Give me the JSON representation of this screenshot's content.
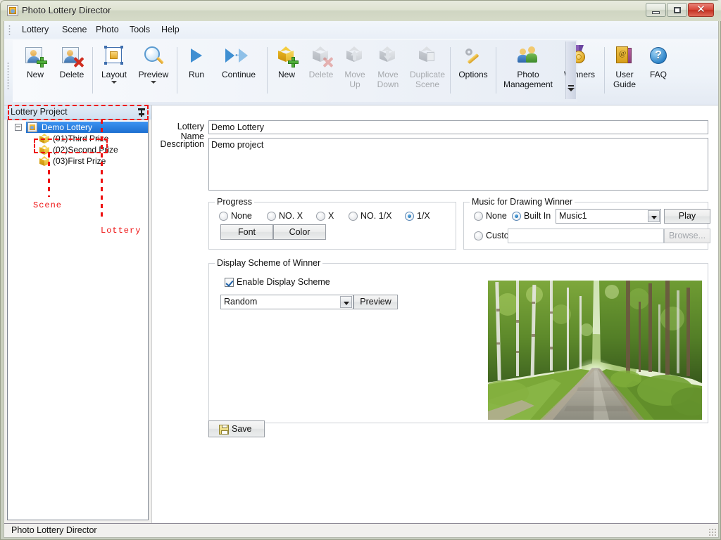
{
  "window": {
    "title": "Photo Lottery Director",
    "icon": "app-icon",
    "buttons": {
      "minimize": "minimize",
      "maximize": "maximize",
      "close": "✕"
    }
  },
  "menubar": {
    "items": [
      {
        "label": "Lottery"
      },
      {
        "label": "Scene"
      },
      {
        "label": "Photo"
      },
      {
        "label": "Tools"
      },
      {
        "label": "Help"
      }
    ]
  },
  "toolbar": {
    "items": [
      {
        "label": "New",
        "icon": "photo-add-icon",
        "enabled": true,
        "dropdown": false
      },
      {
        "label": "Delete",
        "icon": "photo-delete-icon",
        "enabled": true,
        "dropdown": false
      },
      {
        "label": "Layout",
        "icon": "layout-icon",
        "enabled": true,
        "dropdown": true
      },
      {
        "label": "Preview",
        "icon": "magnifier-icon",
        "enabled": true,
        "dropdown": true
      },
      {
        "label": "Run",
        "icon": "play-icon",
        "enabled": true,
        "dropdown": false
      },
      {
        "label": "Continue",
        "icon": "fast-forward-icon",
        "enabled": true,
        "dropdown": false
      },
      {
        "label": "New",
        "icon": "cube-add-icon",
        "enabled": true,
        "dropdown": false
      },
      {
        "label": "Delete",
        "icon": "cube-delete-icon",
        "enabled": false,
        "dropdown": false
      },
      {
        "label": "Move\nUp",
        "icon": "cube-move-up-icon",
        "enabled": false,
        "dropdown": false
      },
      {
        "label": "Move\nDown",
        "icon": "cube-move-down-icon",
        "enabled": false,
        "dropdown": false
      },
      {
        "label": "Duplicate\nScene",
        "icon": "cube-duplicate-icon",
        "enabled": false,
        "dropdown": false
      },
      {
        "label": "Options",
        "icon": "wrench-icon",
        "enabled": true,
        "dropdown": false
      },
      {
        "label": "Photo\nManagement",
        "icon": "people-icon",
        "enabled": true,
        "dropdown": false
      },
      {
        "label": "Winners",
        "icon": "medal-icon",
        "enabled": true,
        "dropdown": false
      },
      {
        "label": "User\nGuide",
        "icon": "book-icon",
        "enabled": true,
        "dropdown": false
      },
      {
        "label": "FAQ",
        "icon": "question-icon",
        "enabled": true,
        "dropdown": false
      }
    ],
    "overflow_icon": "overflow-chevron-icon"
  },
  "sidebar": {
    "title": "Lottery Project",
    "pin_icon": "pin-icon",
    "tree": {
      "root": {
        "label": "Demo Lottery",
        "icon": "lottery-icon",
        "selected": true,
        "expander": "collapse-icon"
      },
      "children": [
        {
          "label": "(01)Third Prize",
          "icon": "scene-cube-icon"
        },
        {
          "label": "(02)Second Prize",
          "icon": "scene-cube-icon"
        },
        {
          "label": "(03)First Prize",
          "icon": "scene-cube-icon"
        }
      ]
    },
    "annotations": [
      {
        "label": "Scene",
        "color": "#ee1111"
      },
      {
        "label": "Lottery",
        "color": "#ee1111"
      }
    ]
  },
  "form": {
    "lottery_name": {
      "label": "Lottery Name",
      "value": "Demo Lottery"
    },
    "description": {
      "label": "Description",
      "value": "Demo project"
    },
    "progress": {
      "title": "Progress",
      "options": [
        {
          "label": "None",
          "selected": false
        },
        {
          "label": "NO. X",
          "selected": false
        },
        {
          "label": "X",
          "selected": false
        },
        {
          "label": "NO. 1/X",
          "selected": false
        },
        {
          "label": "1/X",
          "selected": true
        }
      ],
      "font_button": "Font",
      "color_button": "Color"
    },
    "music": {
      "title": "Music for Drawing Winner",
      "options": [
        {
          "label": "None",
          "selected": false
        },
        {
          "label": "Built In",
          "selected": true
        },
        {
          "label": "Custom",
          "selected": false
        }
      ],
      "builtin_value": "Music1",
      "play_button": "Play",
      "custom_value": "",
      "browse_button": "Browse...",
      "browse_enabled": false
    },
    "display_scheme": {
      "title": "Display Scheme of Winner",
      "enable_label": "Enable Display Scheme",
      "enabled": true,
      "scheme_value": "Random",
      "preview_button": "Preview",
      "photo_alt": "forest-road-photo"
    },
    "save_button": "Save",
    "save_icon": "floppy-disk-icon"
  },
  "statusbar": {
    "text": "Photo Lottery Director"
  },
  "colors": {
    "accent": "#1d6fd0",
    "annotation": "#ee1111",
    "titlebar": "#d6dbc8",
    "close_button": "#c33021"
  }
}
